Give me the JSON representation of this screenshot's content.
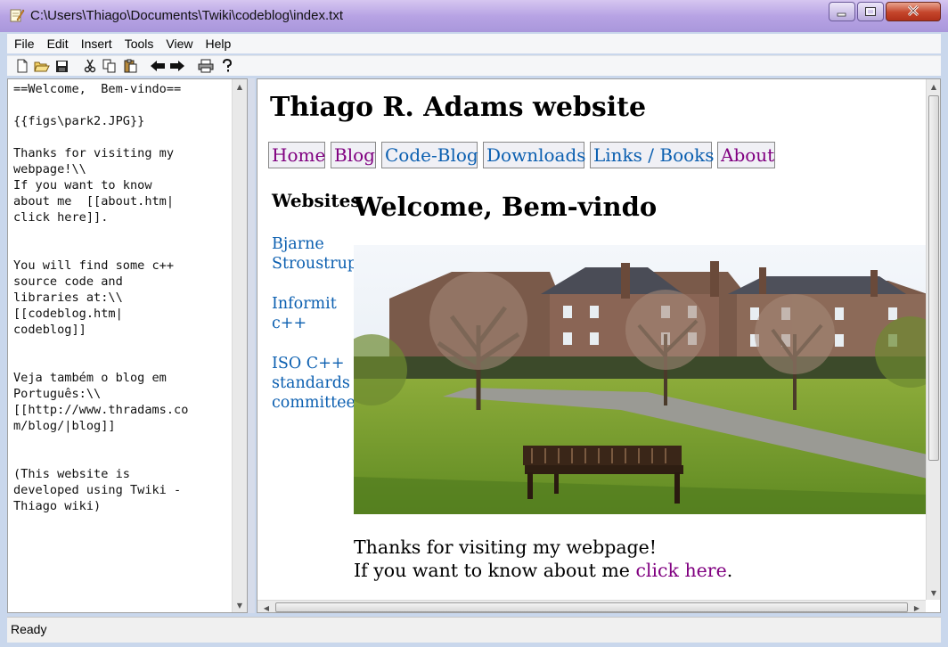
{
  "window": {
    "title": "C:\\Users\\Thiago\\Documents\\Twiki\\codeblog\\index.txt"
  },
  "menu": {
    "items": [
      {
        "label": "File",
        "name": "menu-file"
      },
      {
        "label": "Edit",
        "name": "menu-edit"
      },
      {
        "label": "Insert",
        "name": "menu-insert"
      },
      {
        "label": "Tools",
        "name": "menu-tools"
      },
      {
        "label": "View",
        "name": "menu-view"
      },
      {
        "label": "Help",
        "name": "menu-help"
      }
    ]
  },
  "toolbar": {
    "icons": [
      "new-file-icon",
      "open-folder-icon",
      "save-icon",
      "cut-icon",
      "copy-icon",
      "paste-icon",
      "back-arrow-icon",
      "forward-arrow-icon",
      "print-icon",
      "help-icon"
    ]
  },
  "editor": {
    "text": "==Welcome,  Bem-vindo==\n\n{{figs\\park2.JPG}}\n\nThanks for visiting my\nwebpage!\\\\\nIf you want to know\nabout me  [[about.htm|\nclick here]].\n\n\nYou will find some c++\nsource code and\nlibraries at:\\\\\n[[codeblog.htm|\ncodeblog]]\n\n\nVeja também o blog em\nPortuguês:\\\\\n[[http://www.thradams.co\nm/blog/|blog]]\n\n\n(This website is\ndeveloped using Twiki -\nThiago wiki)"
  },
  "preview": {
    "site_title": "Thiago R. Adams website",
    "nav": [
      {
        "label": "Home",
        "visited": true
      },
      {
        "label": "Blog",
        "visited": true
      },
      {
        "label": "Code-Blog",
        "visited": false
      },
      {
        "label": "Downloads",
        "visited": false
      },
      {
        "label": "Links / Books",
        "visited": false
      },
      {
        "label": "About",
        "visited": true
      }
    ],
    "sidebar_heading": "Websites",
    "sidebar_links": [
      "Bjarne\nStroustrup",
      "Informit\nc++",
      "ISO C++\nstandards\ncommittee"
    ],
    "heading": "Welcome, Bem-vindo",
    "body_line1": "Thanks for visiting my webpage!",
    "body_line2_prefix": "If you want to know about me ",
    "body_link": "click here",
    "body_line2_suffix": "."
  },
  "status": {
    "text": "Ready"
  },
  "colors": {
    "link_visited": "#800080",
    "link_unvisited": "#0b5fb0",
    "titlebar": "#b7a3e4",
    "close_button": "#c4452b"
  }
}
